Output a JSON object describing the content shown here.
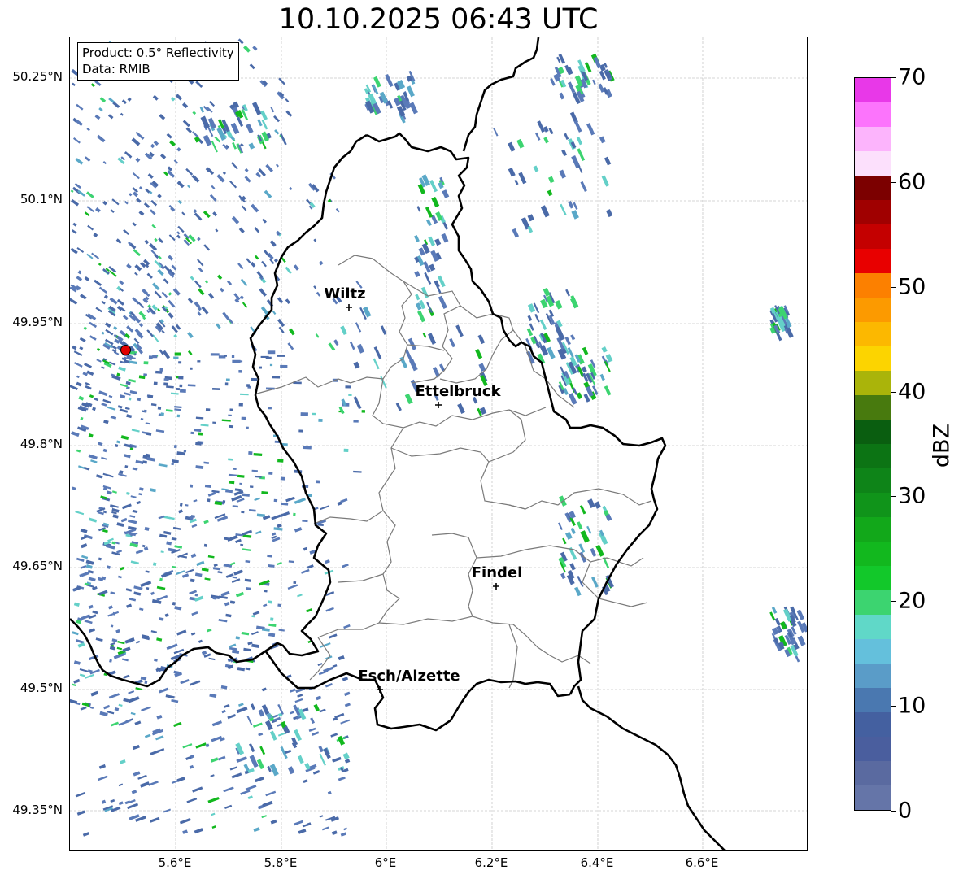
{
  "title": "10.10.2025 06:43 UTC",
  "info": {
    "product": "Product: 0.5° Reflectivity",
    "data": "Data: RMIB"
  },
  "y_labels": [
    "50.25°N",
    "50.1°N",
    "49.95°N",
    "49.8°N",
    "49.65°N",
    "49.5°N",
    "49.35°N"
  ],
  "x_labels": [
    "5.6°E",
    "5.8°E",
    "6°E",
    "6.2°E",
    "6.4°E",
    "6.6°E"
  ],
  "cities": [
    {
      "name": "Wiltz"
    },
    {
      "name": "Ettelbruck"
    },
    {
      "name": "Findel"
    },
    {
      "name": "Esch/Alzette"
    }
  ],
  "colorbar": {
    "label": "dBZ",
    "ticks": [
      "0",
      "10",
      "20",
      "30",
      "40",
      "50",
      "60",
      "70"
    ],
    "colors": [
      "#6575a8",
      "#5a6aa0",
      "#4a5e9e",
      "#4460a0",
      "#4a78b0",
      "#5a9cc8",
      "#64c0dc",
      "#60d8c8",
      "#3cd470",
      "#12c82a",
      "#12b81e",
      "#12a81a",
      "#10941a",
      "#0e8418",
      "#0c7414",
      "#0a5e10",
      "#487a0e",
      "#aab40a",
      "#fcd400",
      "#fcb800",
      "#fc9a00",
      "#fc8000",
      "#e80000",
      "#c40000",
      "#a00000",
      "#7c0000",
      "#fce0fc",
      "#fcb4fc",
      "#fc74fc",
      "#e838e8"
    ],
    "range": [
      0,
      70
    ]
  },
  "map": {
    "lon_range": [
      5.4,
      6.8
    ],
    "lat_range": [
      49.3,
      50.3
    ],
    "radar_site": {
      "lon": 5.51,
      "lat": 49.91
    },
    "echo_colors": [
      "#4a6aa8",
      "#5a7ab8",
      "#5aa8c8",
      "#64d0c8",
      "#3cd470",
      "#12b81e"
    ]
  }
}
